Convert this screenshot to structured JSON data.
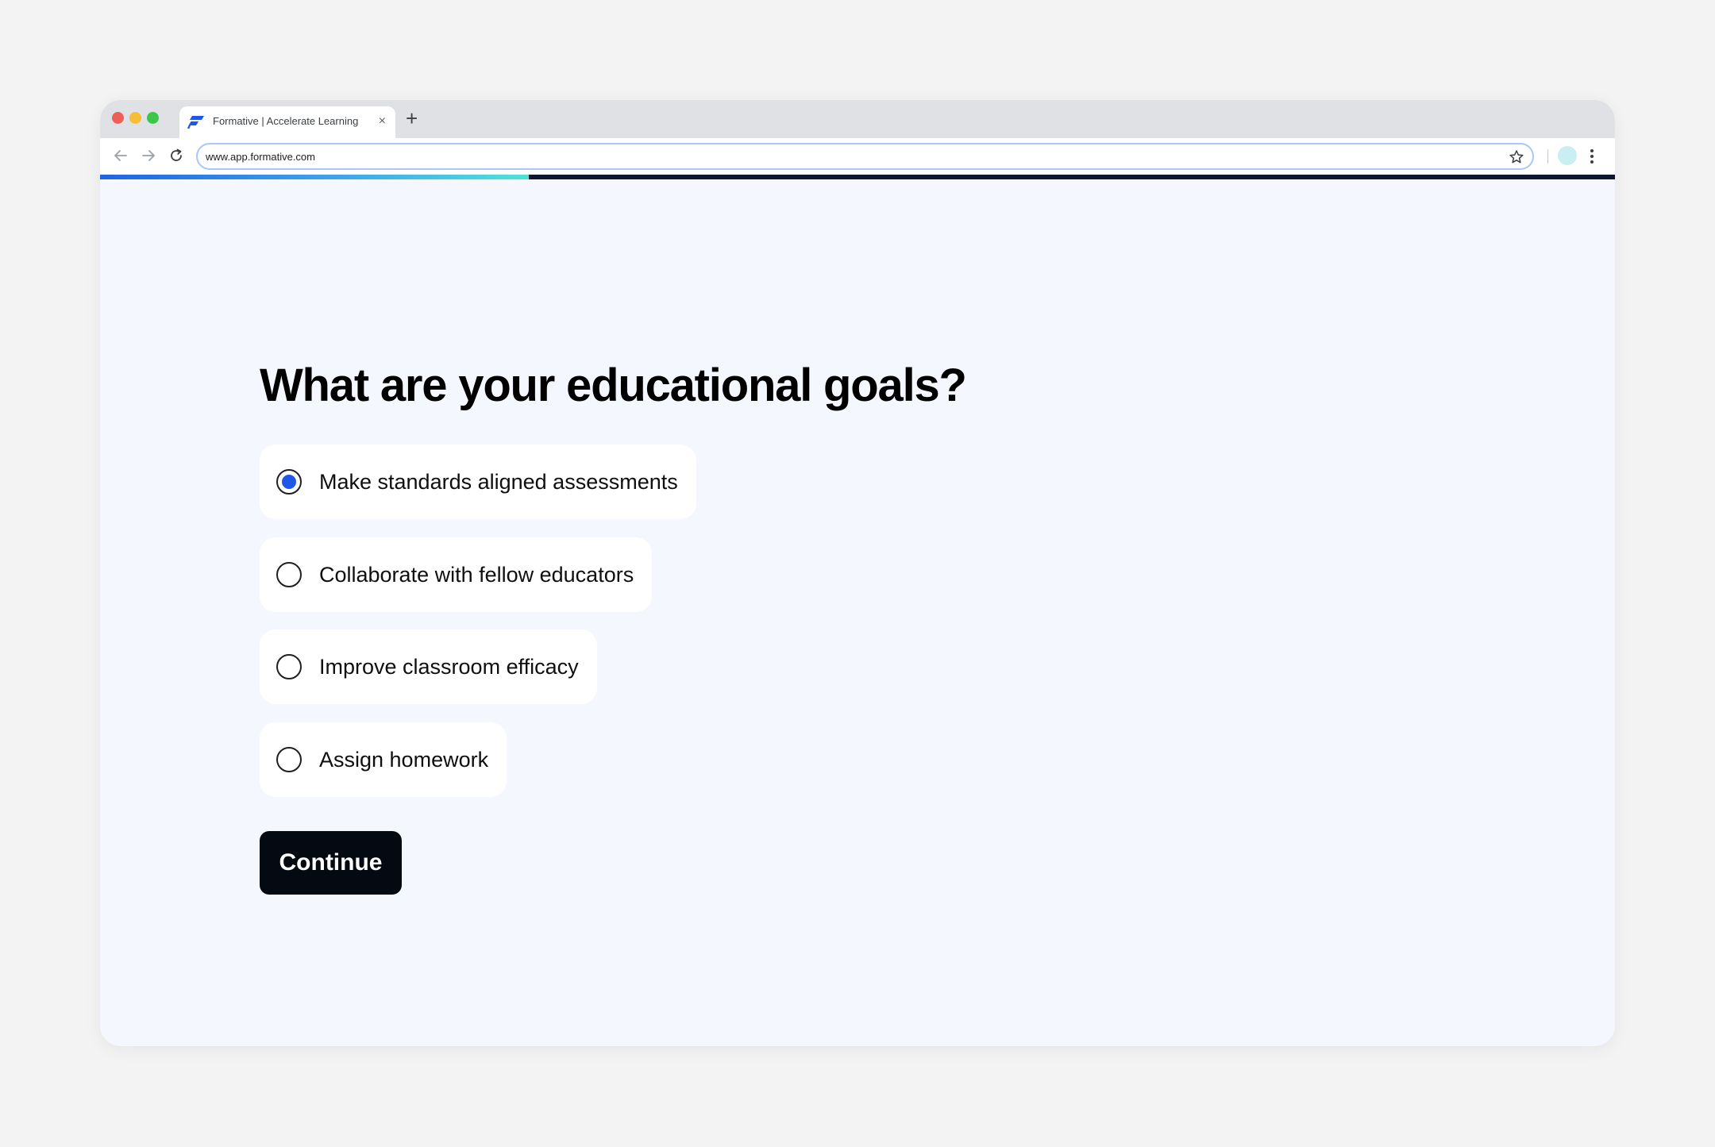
{
  "browser": {
    "tab_title": "Formative | Accelerate Learning",
    "tab_close": "×",
    "new_tab": "+",
    "url": "www.app.formative.com",
    "icons": [
      "formative-logo-icon",
      "back-arrow-icon",
      "forward-arrow-icon",
      "reload-icon",
      "star-icon",
      "profile-avatar",
      "kebab-menu-icon"
    ]
  },
  "progress": {
    "value": 0.283
  },
  "page": {
    "heading": "What are your educational goals?",
    "options": [
      {
        "label": "Make standards aligned assessments",
        "selected": true
      },
      {
        "label": "Collaborate with fellow educators",
        "selected": false
      },
      {
        "label": "Improve classroom efficacy",
        "selected": false
      },
      {
        "label": "Assign homework",
        "selected": false
      }
    ],
    "continue_label": "Continue"
  },
  "colors": {
    "accent": "#1f58e6",
    "button": "#050912",
    "page_background": "#f4f7fe"
  }
}
